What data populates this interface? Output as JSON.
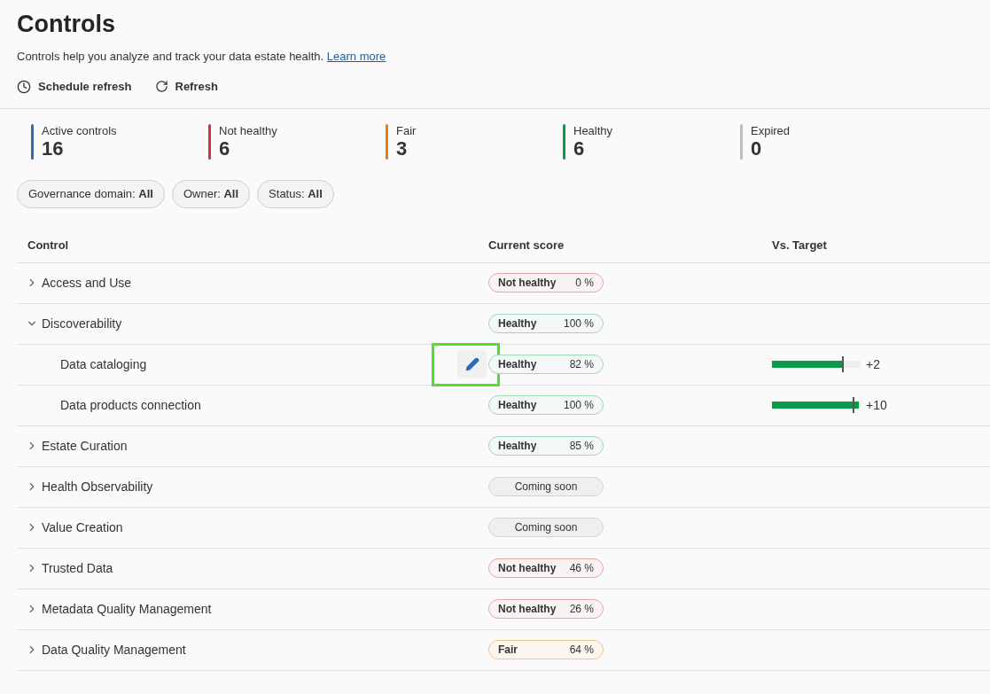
{
  "title": "Controls",
  "description": "Controls help you analyze and track your data estate health.",
  "learn_more": "Learn more",
  "toolbar": [
    {
      "kind": "clock",
      "label": "Schedule refresh"
    },
    {
      "kind": "refresh",
      "label": "Refresh"
    }
  ],
  "summary": [
    {
      "label": "Active controls",
      "value": "16",
      "color": "#2f6cb3"
    },
    {
      "label": "Not healthy",
      "value": "6",
      "color": "#d13438"
    },
    {
      "label": "Fair",
      "value": "3",
      "color": "#e8800f"
    },
    {
      "label": "Healthy",
      "value": "6",
      "color": "#0b9a4a"
    },
    {
      "label": "Expired",
      "value": "0",
      "color": "#bdbdbd"
    }
  ],
  "filters": [
    {
      "label": "Governance domain:",
      "value": "All"
    },
    {
      "label": "Owner:",
      "value": "All"
    },
    {
      "label": "Status:",
      "value": "All"
    }
  ],
  "table": {
    "columns": [
      "Control",
      "Current score",
      "Vs. Target"
    ],
    "rows": [
      {
        "name": "Access and Use",
        "expanded": false,
        "kind": "not_healthy",
        "status_label": "Not healthy",
        "score": "0 %"
      },
      {
        "name": "Discoverability",
        "expanded": true,
        "kind": "healthy",
        "status_label": "Healthy",
        "score": "100 %",
        "children": [
          {
            "name": "Data cataloging",
            "kind": "healthy",
            "status_label": "Healthy",
            "score": "82 %",
            "edit_highlighted": true,
            "level": 0.8,
            "delta": "+2"
          },
          {
            "name": "Data products connection",
            "kind": "healthy",
            "status_label": "Healthy",
            "score": "100 %",
            "level": 0.98,
            "delta": "+10"
          }
        ]
      },
      {
        "name": "Estate Curation",
        "expanded": false,
        "kind": "healthy",
        "status_label": "Healthy",
        "score": "85 %"
      },
      {
        "name": "Health Observability",
        "expanded": false,
        "kind": "coming_soon",
        "status_label": "Coming soon"
      },
      {
        "name": "Value Creation",
        "expanded": false,
        "kind": "coming_soon",
        "status_label": "Coming soon"
      },
      {
        "name": "Trusted Data",
        "expanded": false,
        "kind": "not_healthy",
        "status_label": "Not healthy",
        "score": "46 %"
      },
      {
        "name": "Metadata Quality Management",
        "expanded": false,
        "kind": "not_healthy",
        "status_label": "Not healthy",
        "score": "26 %"
      },
      {
        "name": "Data Quality Management",
        "expanded": false,
        "kind": "fair",
        "status_label": "Fair",
        "score": "64 %"
      }
    ]
  }
}
